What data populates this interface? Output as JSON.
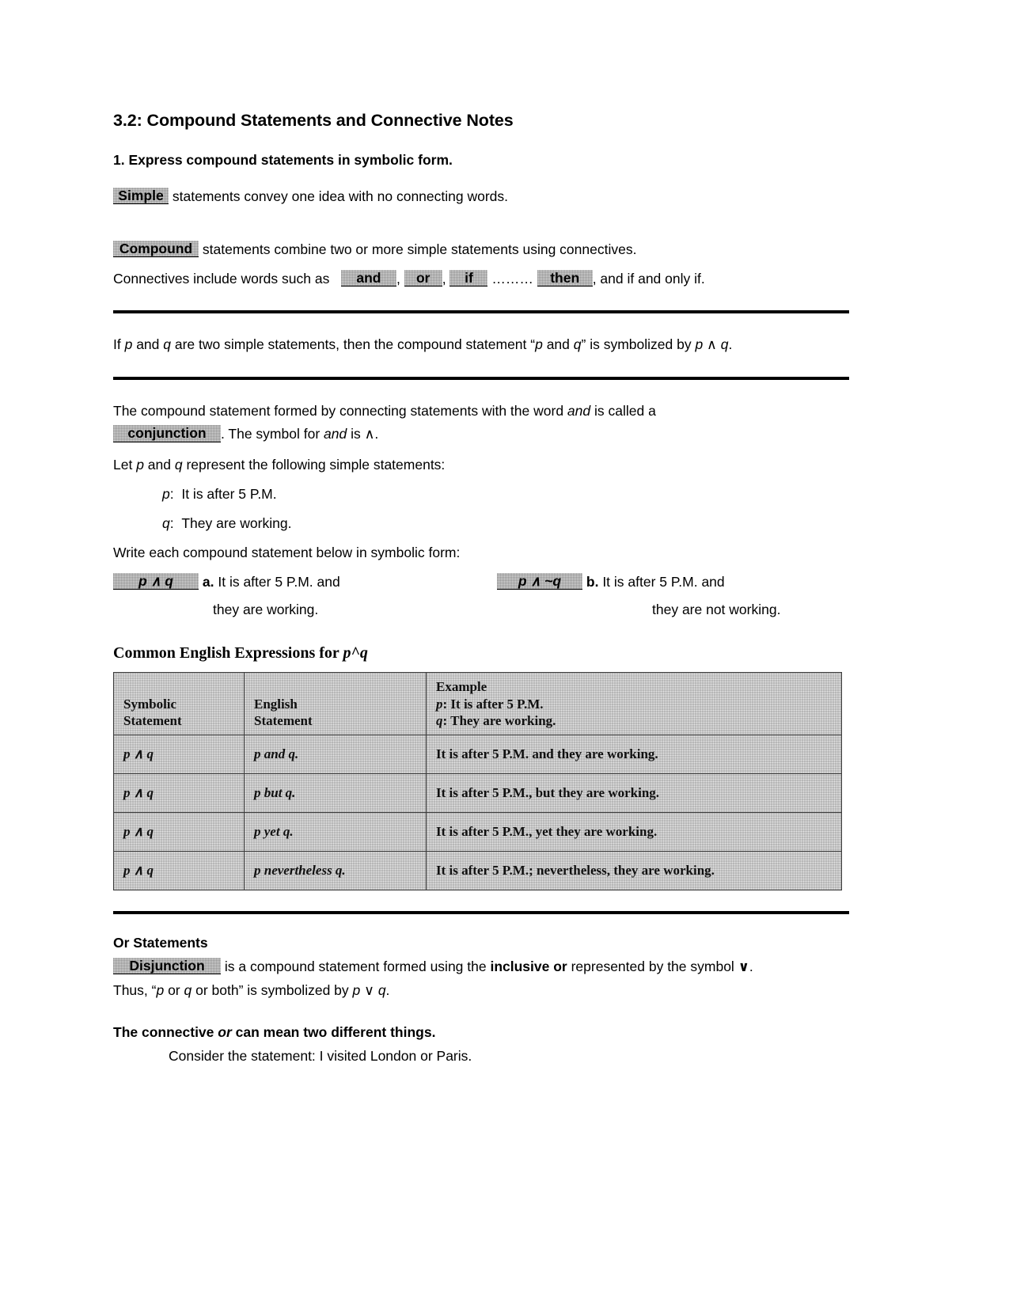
{
  "document": {
    "title": "3.2: Compound Statements and Connective Notes",
    "objective": "1. Express compound statements in symbolic form."
  },
  "simple_line": {
    "blank": "Simple",
    "text": "statements convey one idea with no connecting words."
  },
  "compound_line": {
    "blank": "Compound",
    "text": "statements combine two or more simple statements using connectives."
  },
  "connectives_line": {
    "lead": "Connectives include words such as",
    "blank_and": "and",
    "sep1": ",",
    "blank_or": "or",
    "sep2": ",",
    "blank_if": "if",
    "dots": "………",
    "blank_then": "then",
    "tail": ", and if and only if."
  },
  "definition_box": {
    "text_a": "If ",
    "p": "p",
    "text_b": " and ",
    "q": "q",
    "text_c": " are two simple statements, then the compound statement “",
    "text_d": " and ",
    "text_e": "” is symbolized by ",
    "symbol": "∧",
    "text_f": "."
  },
  "conjunction_para": {
    "line1_a": "The compound statement formed by connecting statements with the word ",
    "line1_and": "and",
    "line1_b": " is called a",
    "blank": "conjunction",
    "line2_a": ". The symbol for ",
    "line2_and": "and",
    "line2_b": " is ",
    "line2_symbol": "∧",
    "line2_c": "."
  },
  "let_line": {
    "a": "Let ",
    "p": "p",
    "b": " and ",
    "q": "q",
    "c": " represent the following simple statements:"
  },
  "statements": [
    {
      "var": "p",
      "colon": ":",
      "text": "It is after 5 P.M."
    },
    {
      "var": "q",
      "colon": ":",
      "text": "They are working."
    }
  ],
  "write_prompt": "Write each compound statement below in symbolic form:",
  "answers": [
    {
      "blank": "p ∧ q",
      "letter": "a.",
      "line1": "It is after 5 P.M. and",
      "line2": "they are working."
    },
    {
      "blank": "p ∧ ~q",
      "letter": "b.",
      "line1": "It is after 5 P.M. and",
      "line2": "they are not working."
    }
  ],
  "table_section": {
    "heading_text": "Common English Expressions for ",
    "heading_math": "p^q",
    "headers": {
      "col1_line1": "Symbolic",
      "col1_line2": "Statement",
      "col2_line1": "English",
      "col2_line2": "Statement",
      "col3_line1": "Example",
      "col3_line2_var": "p",
      "col3_line2_text": ": It is after 5 P.M.",
      "col3_line3_var": "q",
      "col3_line3_text": ": They are working."
    },
    "rows": [
      {
        "symbolic": "p ∧ q",
        "english": "p and q.",
        "example": "It is after 5 P.M. and they are working."
      },
      {
        "symbolic": "p ∧ q",
        "english": "p but q.",
        "example": "It is after 5 P.M., but they are working."
      },
      {
        "symbolic": "p ∧ q",
        "english": "p yet q.",
        "example": "It is after 5 P.M., yet they are working."
      },
      {
        "symbolic": "p ∧ q",
        "english": "p nevertheless q.",
        "example": "It is after 5 P.M.; nevertheless, they are working."
      }
    ]
  },
  "or_section": {
    "heading": "Or Statements",
    "blank": "Disjunction",
    "line1_a": " is a compound statement formed using the ",
    "line1_bold": "inclusive or",
    "line1_b": " represented by the symbol  ",
    "line1_symbol": "∨",
    "line1_c": ".",
    "line2_a": "Thus, “",
    "line2_p": "p",
    "line2_b": " or ",
    "line2_q": "q",
    "line2_c": " or both” is symbolized by ",
    "line2_symbol": "∨",
    "line2_d": "."
  },
  "connective_section": {
    "heading_a": "The connective ",
    "heading_or": "or",
    "heading_b": " can mean two different things.",
    "body": "Consider the statement: I visited London or Paris."
  },
  "colors": {
    "text": "#000000",
    "blank_fill": "#d8d8d8",
    "table_fill": "#e2e2e2",
    "rule": "#000000"
  }
}
